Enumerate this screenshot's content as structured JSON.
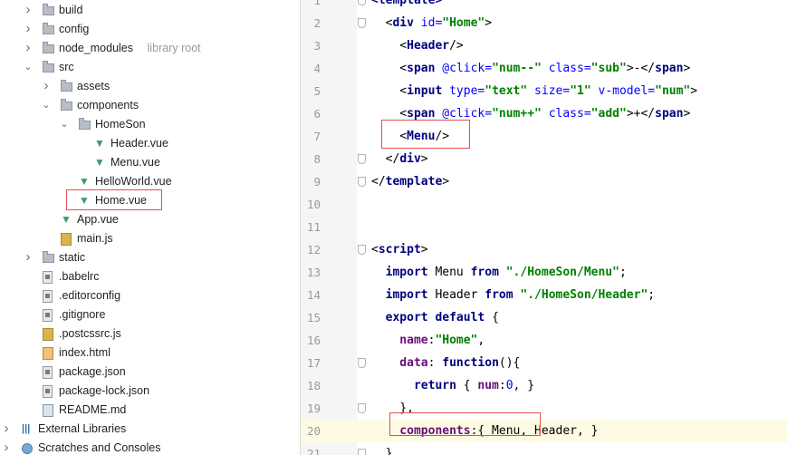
{
  "tree": {
    "items": [
      {
        "label": "build",
        "depth": 0,
        "arrow": "›",
        "icon": "folder-icon"
      },
      {
        "label": "config",
        "depth": 0,
        "arrow": "›",
        "icon": "folder-icon"
      },
      {
        "label": "node_modules",
        "sub": "library root",
        "depth": 0,
        "arrow": "›",
        "icon": "folder-icon"
      },
      {
        "label": "src",
        "depth": 0,
        "arrow": "⌄",
        "icon": "folder-icon"
      },
      {
        "label": "assets",
        "depth": 1,
        "arrow": "›",
        "icon": "folder-icon"
      },
      {
        "label": "components",
        "depth": 1,
        "arrow": "⌄",
        "icon": "folder-icon"
      },
      {
        "label": "HomeSon",
        "depth": 2,
        "arrow": "⌄",
        "icon": "folder-icon"
      },
      {
        "label": "Header.vue",
        "depth": 3,
        "arrow": "",
        "icon": "vue-file-icon"
      },
      {
        "label": "Menu.vue",
        "depth": 3,
        "arrow": "",
        "icon": "vue-file-icon"
      },
      {
        "label": "HelloWorld.vue",
        "depth": 2,
        "arrow": "",
        "icon": "vue-file-icon"
      },
      {
        "label": "Home.vue",
        "depth": 2,
        "arrow": "",
        "icon": "vue-file-icon"
      },
      {
        "label": "App.vue",
        "depth": 1,
        "arrow": "",
        "icon": "vue-file-icon"
      },
      {
        "label": "main.js",
        "depth": 1,
        "arrow": "",
        "icon": "js-file-icon"
      },
      {
        "label": "static",
        "depth": 0,
        "arrow": "›",
        "icon": "folder-icon"
      },
      {
        "label": ".babelrc",
        "depth": 0,
        "arrow": "",
        "icon": "config-file-icon"
      },
      {
        "label": ".editorconfig",
        "depth": 0,
        "arrow": "",
        "icon": "config-file-icon"
      },
      {
        "label": ".gitignore",
        "depth": 0,
        "arrow": "",
        "icon": "config-file-icon"
      },
      {
        "label": ".postcssrc.js",
        "depth": 0,
        "arrow": "",
        "icon": "js-file-icon"
      },
      {
        "label": "index.html",
        "depth": 0,
        "arrow": "",
        "icon": "html-file-icon"
      },
      {
        "label": "package.json",
        "depth": 0,
        "arrow": "",
        "icon": "config-file-icon"
      },
      {
        "label": "package-lock.json",
        "depth": 0,
        "arrow": "",
        "icon": "config-file-icon"
      },
      {
        "label": "README.md",
        "depth": 0,
        "arrow": "",
        "icon": "md-file-icon"
      },
      {
        "label": "External Libraries",
        "depth": -1,
        "arrow": "›",
        "icon": "libraries-icon"
      },
      {
        "label": "Scratches and Consoles",
        "depth": -1,
        "arrow": "›",
        "icon": "scratches-icon"
      }
    ]
  },
  "editor": {
    "current_line": "20",
    "lines": [
      {
        "n": "1",
        "t": [
          [
            "tag",
            "<template>"
          ]
        ]
      },
      {
        "n": "2",
        "t": [
          [
            "punc",
            "  <"
          ],
          [
            "tag",
            "div "
          ],
          [
            "attr",
            "id="
          ],
          [
            "str",
            "\"Home\""
          ],
          [
            "punc",
            ">"
          ]
        ]
      },
      {
        "n": "3",
        "t": [
          [
            "punc",
            "    <"
          ],
          [
            "tag",
            "Header"
          ],
          [
            "punc",
            "/>"
          ]
        ]
      },
      {
        "n": "4",
        "t": [
          [
            "punc",
            "    <"
          ],
          [
            "tag",
            "span "
          ],
          [
            "attr",
            "@click="
          ],
          [
            "str",
            "\"num--\" "
          ],
          [
            "attr",
            "class="
          ],
          [
            "str",
            "\"sub\""
          ],
          [
            "punc",
            ">-</"
          ],
          [
            "tag",
            "span"
          ],
          [
            "punc",
            ">"
          ]
        ]
      },
      {
        "n": "5",
        "t": [
          [
            "punc",
            "    <"
          ],
          [
            "tag",
            "input "
          ],
          [
            "attr",
            "type="
          ],
          [
            "str",
            "\"text\" "
          ],
          [
            "attr",
            "size="
          ],
          [
            "str",
            "\"1\" "
          ],
          [
            "attr",
            "v-model="
          ],
          [
            "str",
            "\"num\""
          ],
          [
            "punc",
            ">"
          ]
        ]
      },
      {
        "n": "6",
        "t": [
          [
            "punc",
            "    <"
          ],
          [
            "tag",
            "span "
          ],
          [
            "attr",
            "@click="
          ],
          [
            "str",
            "\"num++\" "
          ],
          [
            "attr",
            "class="
          ],
          [
            "str",
            "\"add\""
          ],
          [
            "punc",
            ">+</"
          ],
          [
            "tag",
            "span"
          ],
          [
            "punc",
            ">"
          ]
        ]
      },
      {
        "n": "7",
        "t": [
          [
            "punc",
            "    <"
          ],
          [
            "tag",
            "Menu"
          ],
          [
            "punc",
            "/>"
          ]
        ]
      },
      {
        "n": "8",
        "t": [
          [
            "punc",
            "  </"
          ],
          [
            "tag",
            "div"
          ],
          [
            "punc",
            ">"
          ]
        ]
      },
      {
        "n": "9",
        "t": [
          [
            "punc",
            "</"
          ],
          [
            "tag",
            "template"
          ],
          [
            "punc",
            ">"
          ]
        ]
      },
      {
        "n": "10",
        "t": []
      },
      {
        "n": "11",
        "t": []
      },
      {
        "n": "12",
        "t": [
          [
            "punc",
            "<"
          ],
          [
            "tag",
            "script"
          ],
          [
            "punc",
            ">"
          ]
        ]
      },
      {
        "n": "13",
        "t": [
          [
            "kw",
            "  import "
          ],
          [
            "plain",
            "Menu "
          ],
          [
            "kw",
            "from "
          ],
          [
            "str",
            "\"./HomeSon/Menu\""
          ],
          [
            "plain",
            ";"
          ]
        ]
      },
      {
        "n": "14",
        "t": [
          [
            "kw",
            "  import "
          ],
          [
            "plain",
            "Header "
          ],
          [
            "kw",
            "from "
          ],
          [
            "str",
            "\"./HomeSon/Header\""
          ],
          [
            "plain",
            ";"
          ]
        ]
      },
      {
        "n": "15",
        "t": [
          [
            "kw",
            "  export default "
          ],
          [
            "plain",
            "{"
          ]
        ]
      },
      {
        "n": "16",
        "t": [
          [
            "prop",
            "    name"
          ],
          [
            "plain",
            ":"
          ],
          [
            "str",
            "\"Home\""
          ],
          [
            "plain",
            ","
          ]
        ]
      },
      {
        "n": "17",
        "t": [
          [
            "prop",
            "    data"
          ],
          [
            "plain",
            ": "
          ],
          [
            "kw",
            "function"
          ],
          [
            "plain",
            "(){"
          ]
        ]
      },
      {
        "n": "18",
        "t": [
          [
            "kw",
            "      return "
          ],
          [
            "plain",
            "{ "
          ],
          [
            "prop",
            "num"
          ],
          [
            "plain",
            ":"
          ],
          [
            "num",
            "0"
          ],
          [
            "plain",
            ", }"
          ]
        ]
      },
      {
        "n": "19",
        "t": [
          [
            "plain",
            "    },"
          ]
        ]
      },
      {
        "n": "20",
        "t": [
          [
            "prop",
            "    components"
          ],
          [
            "plain",
            ":{ Menu, Header, }"
          ]
        ]
      },
      {
        "n": "21",
        "t": [
          [
            "plain",
            "  }"
          ]
        ]
      }
    ]
  },
  "colors": {
    "highlight_box": "#e05050",
    "current_line_bg": "#fffae3",
    "gutter_bg": "#f5f5f5"
  }
}
